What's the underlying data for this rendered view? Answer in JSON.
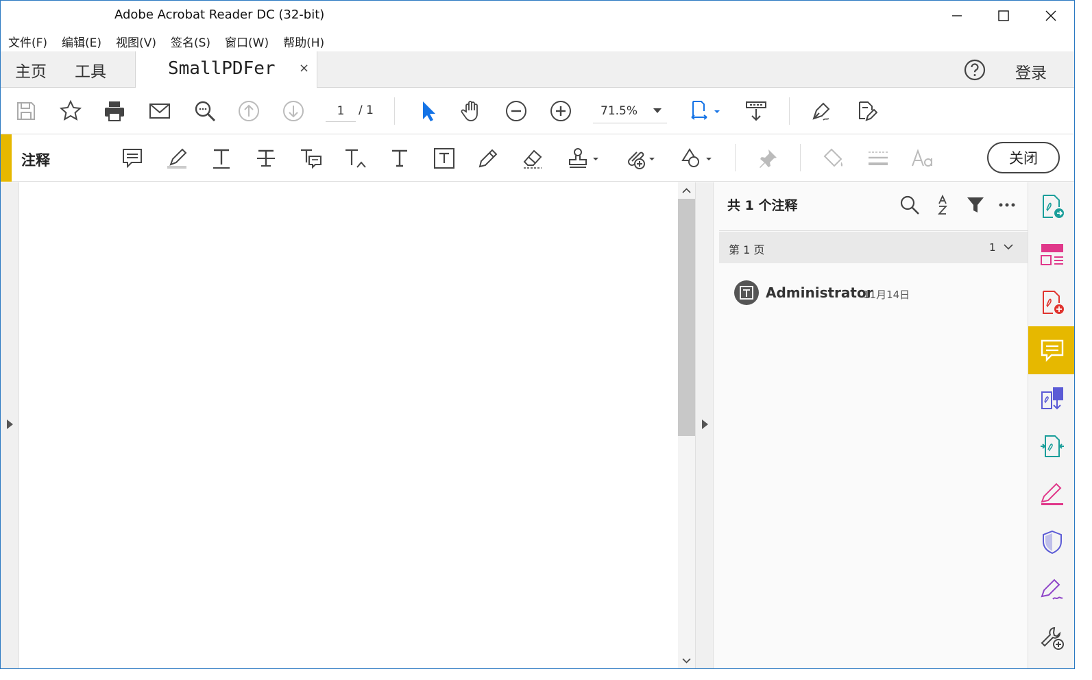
{
  "window": {
    "title": "Adobe Acrobat Reader DC (32-bit)"
  },
  "menu": {
    "items": [
      "文件(F)",
      "编辑(E)",
      "视图(V)",
      "签名(S)",
      "窗口(W)",
      "帮助(H)"
    ]
  },
  "tabs": {
    "home": "主页",
    "tools": "工具",
    "document": "SmallPDFer",
    "close_glyph": "×",
    "login": "登录"
  },
  "toolbar": {
    "current_page": "1",
    "total_pages": "/ 1",
    "zoom": "71.5%"
  },
  "comment_toolbar": {
    "label": "注释",
    "close": "关闭",
    "accent_color": "#e6b800"
  },
  "comments_panel": {
    "count_label": "共 1 个注释",
    "page_group": {
      "label": "第 1 页",
      "count": "1"
    },
    "entries": [
      {
        "author": "Administrator",
        "date": "11月14日",
        "icon": "text-box-icon"
      }
    ]
  },
  "right_rail": {
    "items": [
      {
        "icon": "export-pdf-icon",
        "color": "#1a9e9a"
      },
      {
        "icon": "organize-pages-icon",
        "color": "#e0388a"
      },
      {
        "icon": "create-pdf-icon",
        "color": "#e0342f"
      },
      {
        "icon": "comment-icon",
        "color": "#ffffff",
        "active": true
      },
      {
        "icon": "combine-files-icon",
        "color": "#5b5bd6"
      },
      {
        "icon": "compress-pdf-icon",
        "color": "#1a9e9a"
      },
      {
        "icon": "fill-sign-icon",
        "color": "#e0388a"
      },
      {
        "icon": "protect-icon",
        "color": "#5b5bd6"
      },
      {
        "icon": "request-signature-icon",
        "color": "#8e44c8"
      },
      {
        "icon": "more-tools-icon",
        "color": "#444444"
      }
    ]
  }
}
